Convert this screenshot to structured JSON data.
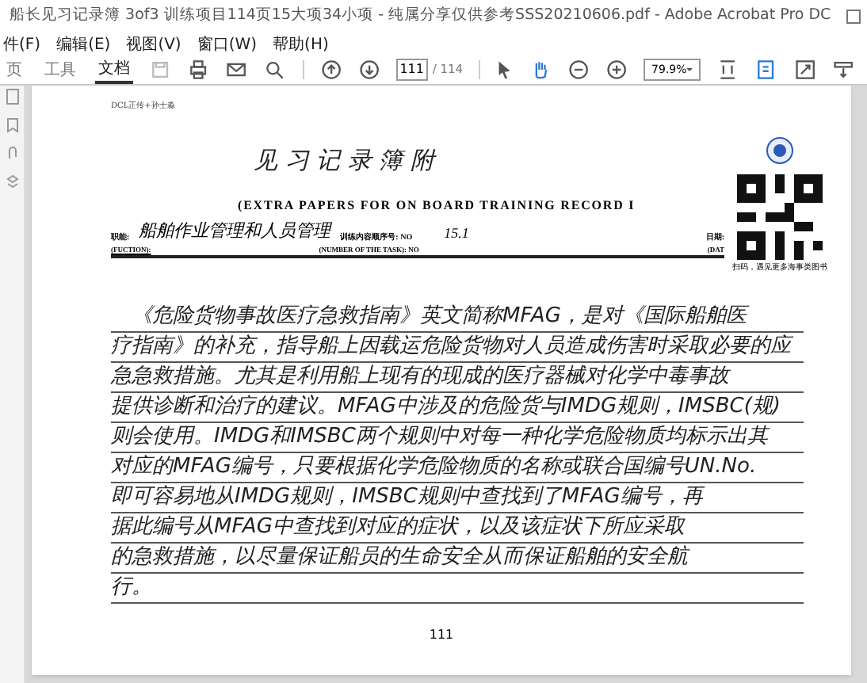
{
  "window": {
    "title": "船长见习记录簿 3of3 训练项目114页15大项34小项 - 纯属分享仅供参考SSS20210606.pdf - Adobe Acrobat Pro DC"
  },
  "menu": [
    "件(F)",
    "编辑(E)",
    "视图(V)",
    "窗口(W)",
    "帮助(H)"
  ],
  "tabs": [
    {
      "label": "页",
      "selected": false
    },
    {
      "label": "工具",
      "selected": false
    },
    {
      "label": "文档",
      "selected": true
    }
  ],
  "page_field": {
    "value": "111"
  },
  "page_total": "/ 114",
  "zoom": {
    "value": "79.9%"
  },
  "document": {
    "header_note": "DCL正传+孙士淼",
    "title": "见 习 记 录 簿 附",
    "subtitle": "(EXTRA PAPERS FOR ON BOARD TRAINING RECORD I",
    "function_label": "职能:",
    "function_value": "船舶作业管理和人员管理",
    "task_label": "训练内容顺序号: NO",
    "task_value": "15.1",
    "date_label": "日期:",
    "function_label_en": "(FUCTION):",
    "task_label_en": "(NUMBER OF THE TASK): NO",
    "date_label_en": "(DAT",
    "qr_caption": "扫码，遇见更多海事类图书",
    "body_lines": [
      "　《危险货物事故医疗急救指南》英文简称MFAG，是对《国际船舶医",
      "疗指南》的补充，指导船上因载运危险货物对人员造成伤害时采取必要的应",
      "急急救措施。尤其是利用船上现有的现成的医疗器械对化学中毒事故",
      "提供诊断和治疗的建议。MFAG中涉及的危险货与IMDG规则，IMSBC(规)",
      "则会使用。IMDG和IMSBC两个规则中对每一种化学危险物质均标示出其",
      "对应的MFAG编号，只要根据化学危险物质的名称或联合国编号UN.No.",
      "即可容易地从IMDG规则，IMSBC规则中查找到了MFAG编号，再",
      "据此编号从MFAG中查找到对应的症状，以及该症状下所应采取",
      "的急救措施，以尽量保证船员的生命安全从而保证船舶的安全航",
      "行。"
    ],
    "page_number": "111"
  }
}
